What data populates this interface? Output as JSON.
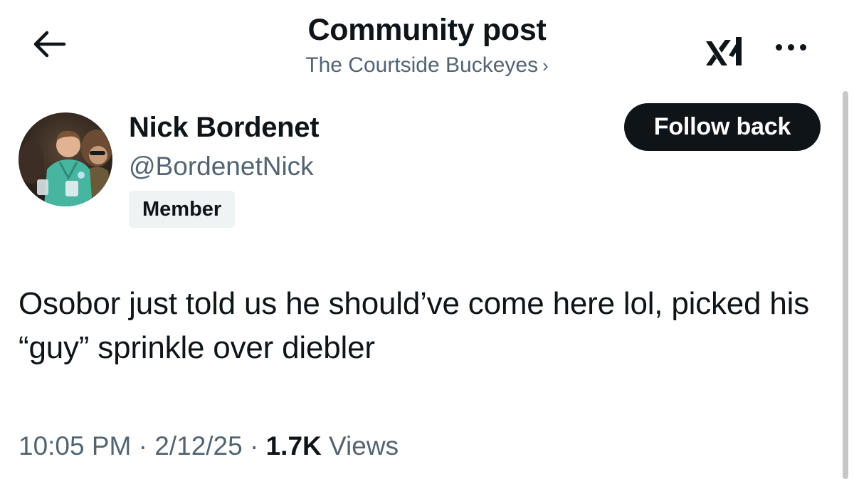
{
  "header": {
    "title": "Community post",
    "community_name": "The Courtside Buckeyes",
    "community_chevron": "›",
    "back_icon": "arrow-left-icon",
    "logo_icon": "xai-logo-icon",
    "more_icon": "more-horizontal-icon"
  },
  "author": {
    "name": "Nick Bordenet",
    "handle": "@BordenetNick",
    "badge": "Member",
    "avatar_icon": "avatar-photo"
  },
  "actions": {
    "follow_label": "Follow back"
  },
  "post": {
    "text": "Osobor just told us he should’ve come here lol, picked his “guy” sprinkle over diebler",
    "time": "10:05 PM",
    "date": "2/12/25",
    "separator": "·",
    "views_count": "1.7K",
    "views_label": "Views"
  },
  "colors": {
    "text_primary": "#0f1419",
    "text_secondary": "#536471",
    "button_bg": "#0f1419",
    "badge_bg": "#eff3f4"
  }
}
